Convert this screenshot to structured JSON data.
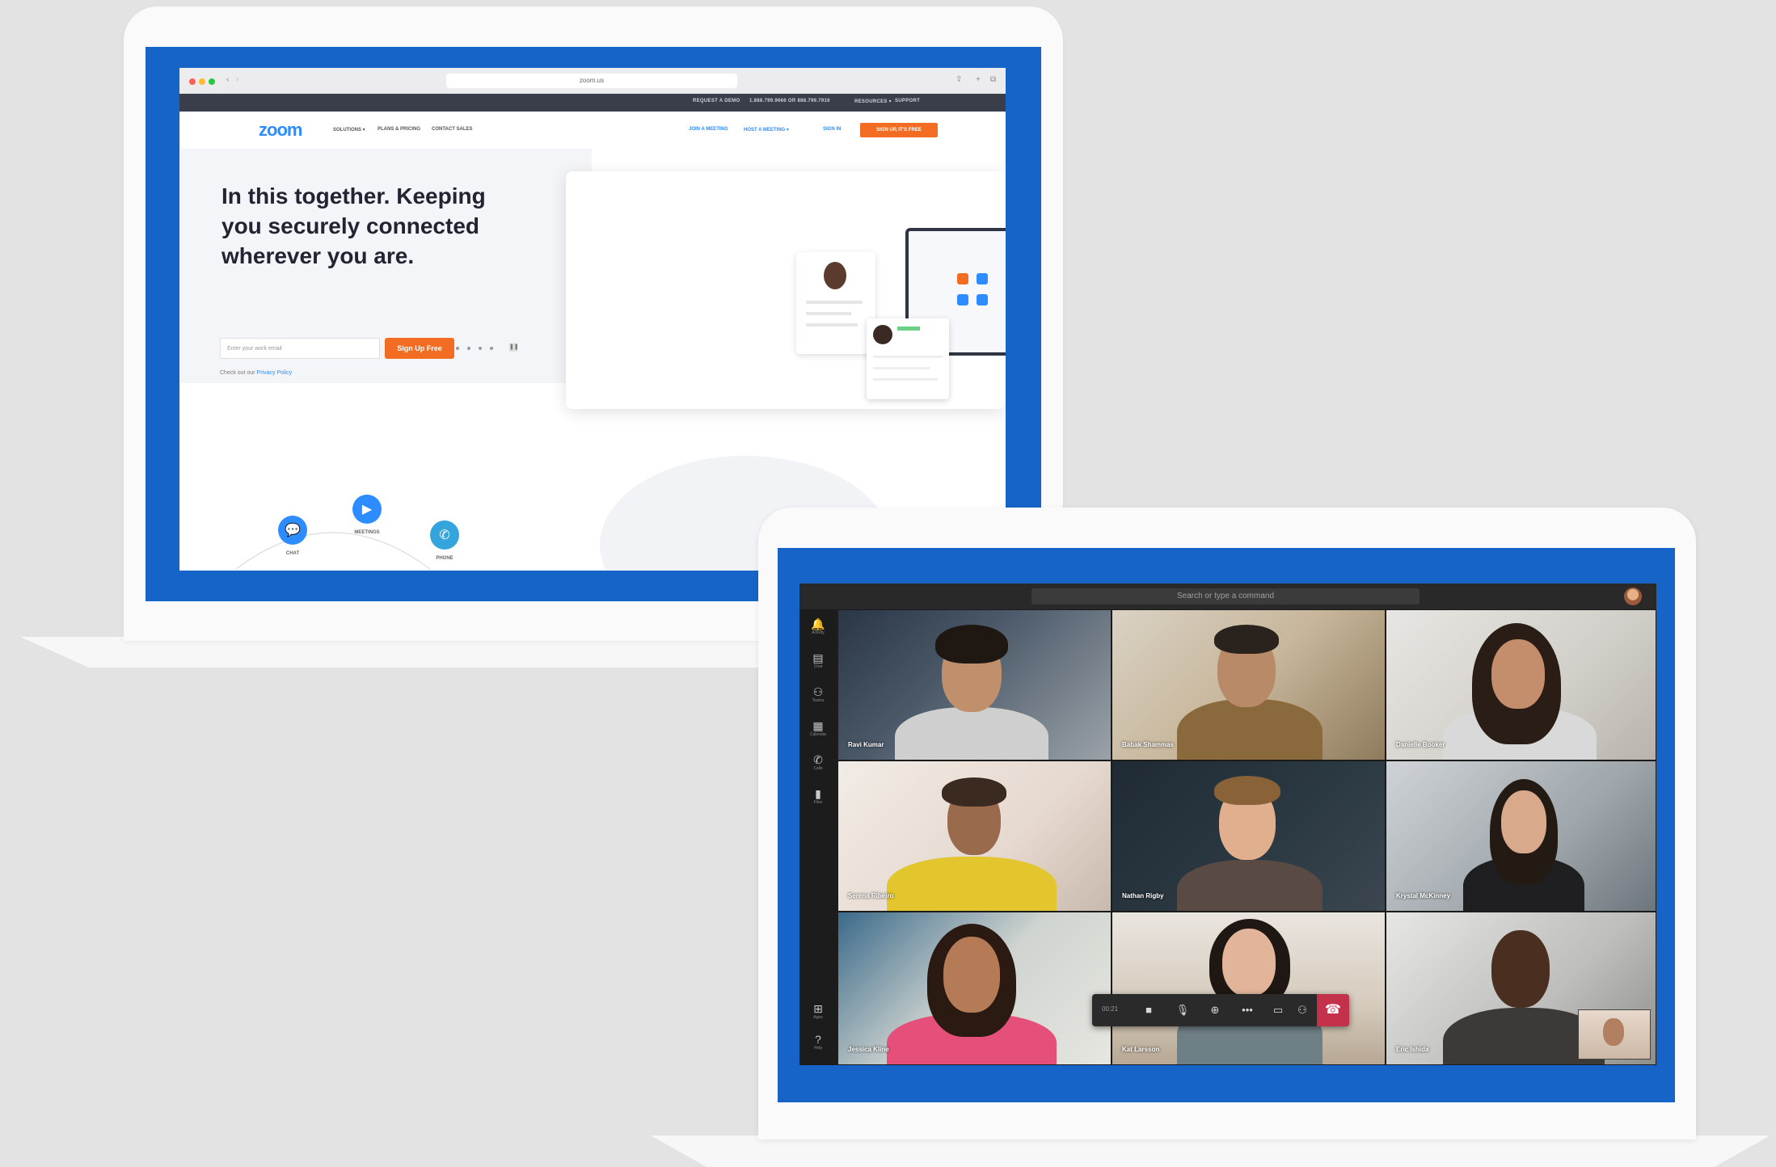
{
  "zoom_page": {
    "browser": {
      "url": "zoom.us"
    },
    "util_nav": [
      "REQUEST A DEMO",
      "1.888.799.9666 OR 888.799.7916",
      "RESOURCES ▾",
      "SUPPORT"
    ],
    "logo": "zoom",
    "nav_left": [
      "SOLUTIONS ▾",
      "PLANS & PRICING",
      "CONTACT SALES"
    ],
    "nav_right": [
      "JOIN A MEETING",
      "HOST A MEETING ▾",
      "SIGN IN"
    ],
    "signup_top": "SIGN UP, IT'S FREE",
    "hero_title": "In this together. Keeping you securely connected wherever you are.",
    "email_placeholder": "Enter your work email",
    "signup_free": "Sign Up Free",
    "privacy_prefix": "Check out our",
    "privacy_link": "Privacy Policy",
    "products": [
      "CHAT",
      "MEETINGS",
      "PHONE"
    ]
  },
  "teams_app": {
    "search_placeholder": "Search or type a command",
    "rail": [
      {
        "icon": "bell-icon",
        "label": "Activity"
      },
      {
        "icon": "chat-icon",
        "label": "Chat"
      },
      {
        "icon": "teams-icon",
        "label": "Teams"
      },
      {
        "icon": "calendar-icon",
        "label": "Calendar"
      },
      {
        "icon": "phone-icon",
        "label": "Calls"
      },
      {
        "icon": "files-icon",
        "label": "Files"
      },
      {
        "icon": "apps-icon",
        "label": "Apps"
      },
      {
        "icon": "help-icon",
        "label": "Help"
      }
    ],
    "participants": [
      "Ravi Kumar",
      "Babak Shammas",
      "Danielle Booker",
      "Serena Ribeiro",
      "Nathan Rigby",
      "Krystal McKinney",
      "Jessica Kline",
      "Kat Larsson",
      "Eric Ishida"
    ],
    "call_timer": "00:21"
  },
  "colors": {
    "zoom_blue": "#2d8cff",
    "zoom_orange": "#f26d21",
    "frame_blue": "#1664c8",
    "hangup_red": "#c4314b"
  }
}
